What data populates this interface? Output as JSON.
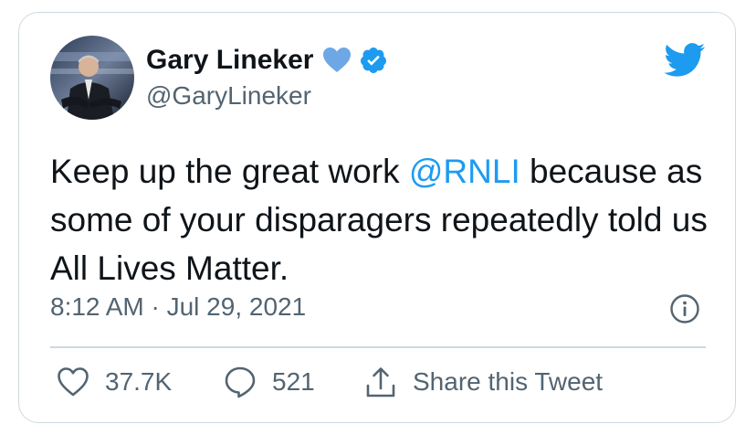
{
  "tweet": {
    "author": {
      "name": "Gary Lineker",
      "handle": "@GaryLineker"
    },
    "text": {
      "before_mention": "Keep up the great work ",
      "mention": "@RNLI",
      "after_mention": " because as some of your disparagers repeatedly told us All Lives Matter."
    },
    "timestamp": "8:12 AM · Jul 29, 2021",
    "actions": {
      "likes": "37.7K",
      "replies": "521",
      "share_label": "Share this Tweet"
    }
  },
  "colors": {
    "accent": "#1d9bf0",
    "heart": "#6ea7e6",
    "muted_text": "#536471",
    "border": "#cfd9de"
  },
  "icons": [
    "verified-badge-icon",
    "blue-heart-icon",
    "twitter-bird-icon",
    "info-icon",
    "heart-icon",
    "reply-bubble-icon",
    "share-icon"
  ]
}
